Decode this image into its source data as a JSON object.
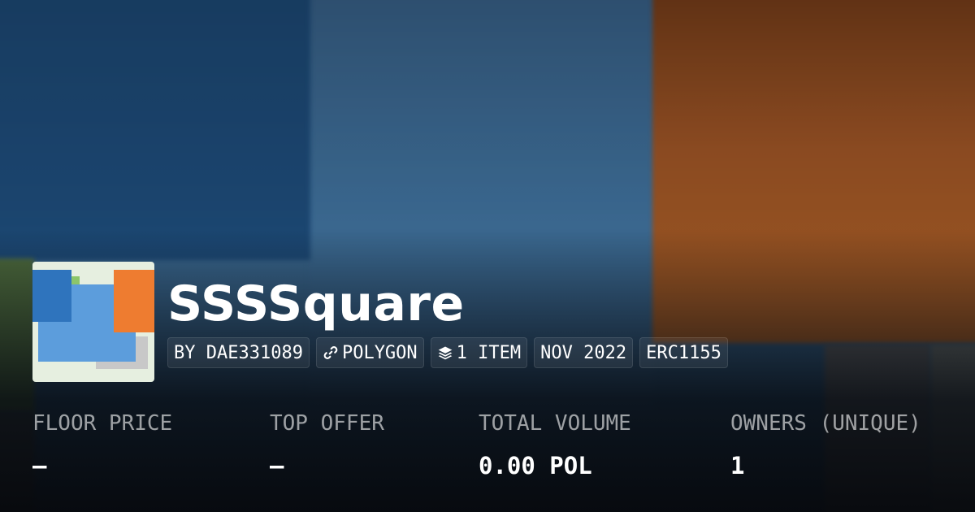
{
  "collection": {
    "name": "SSSSquare",
    "creator": "BY DAE331089",
    "chain": "POLYGON",
    "items": "1 ITEM",
    "created": "NOV 2022",
    "standard": "ERC1155"
  },
  "icons": {
    "chain": "link-icon",
    "items": "layers-icon"
  },
  "stats": {
    "floor_price": {
      "label": "FLOOR PRICE",
      "value": "–"
    },
    "top_offer": {
      "label": "TOP OFFER",
      "value": "–"
    },
    "total_volume": {
      "label": "TOTAL VOLUME",
      "value": "0.00 POL"
    },
    "owners": {
      "label": "OWNERS (UNIQUE)",
      "value": "1"
    }
  },
  "colors": {
    "background_dark": "#0b0f14",
    "thumb_orange": "#ee7c30",
    "thumb_blue": "#5c9ddc",
    "thumb_dark_blue": "#2f74bd",
    "label_text": "#999999"
  }
}
